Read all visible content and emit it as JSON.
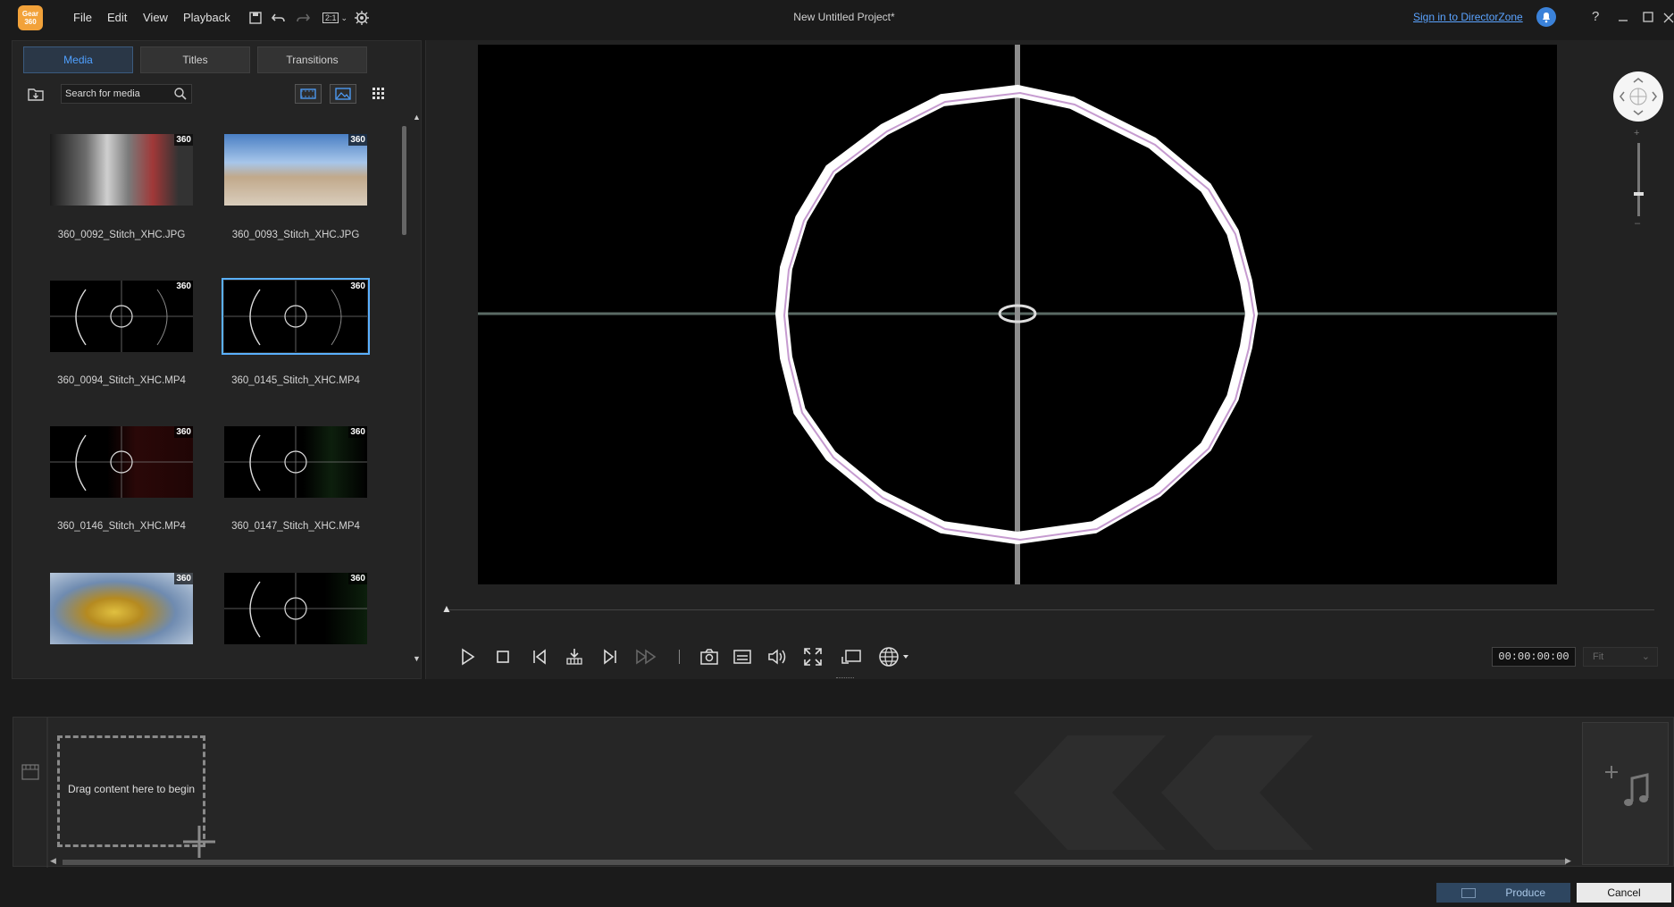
{
  "window": {
    "title": "New Untitled Project*",
    "logo_text": "Gear 360",
    "sign_in": "Sign in to DirectorZone"
  },
  "menu": {
    "file": "File",
    "edit": "Edit",
    "view": "View",
    "playback": "Playback",
    "aspect": "2:1"
  },
  "tabs": [
    {
      "label": "Media",
      "active": true
    },
    {
      "label": "Titles",
      "active": false
    },
    {
      "label": "Transitions",
      "active": false
    }
  ],
  "search": {
    "placeholder": "Search for media"
  },
  "media": [
    {
      "name": "360_0092_Stitch_XHC.JPG",
      "badge": "360"
    },
    {
      "name": "360_0093_Stitch_XHC.JPG",
      "badge": "360"
    },
    {
      "name": "360_0094_Stitch_XHC.MP4",
      "badge": "360"
    },
    {
      "name": "360_0145_Stitch_XHC.MP4",
      "badge": "360",
      "selected": true
    },
    {
      "name": "360_0146_Stitch_XHC.MP4",
      "badge": "360"
    },
    {
      "name": "360_0147_Stitch_XHC.MP4",
      "badge": "360"
    },
    {
      "name": "",
      "badge": "360"
    },
    {
      "name": "",
      "badge": "360"
    }
  ],
  "player": {
    "timecode": "00:00:00:00",
    "fit": "Fit"
  },
  "timeline": {
    "drop_text": "Drag content here to begin"
  },
  "buttons": {
    "produce": "Produce",
    "cancel": "Cancel"
  },
  "colors": {
    "accent": "#4fa0ff",
    "link": "#5aa3ff",
    "logo": "#f2a23a"
  }
}
